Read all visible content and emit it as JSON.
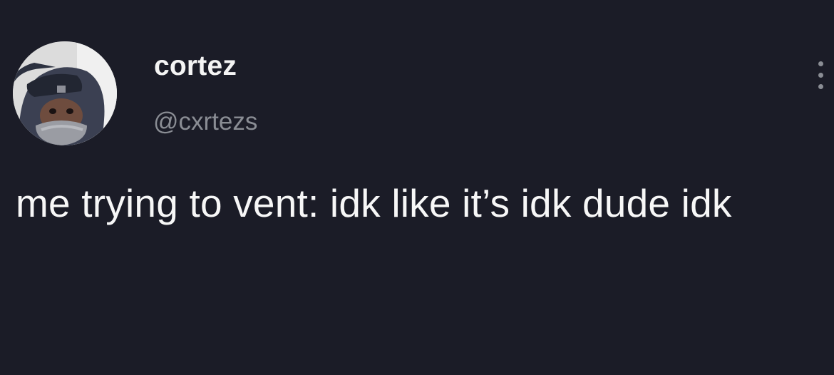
{
  "tweet": {
    "author": {
      "display_name": "cortez",
      "handle": "@cxrtezs",
      "avatar_icon": "profile-photo"
    },
    "more_icon": "more-vertical-icon",
    "text": "me trying to vent: idk like it’s idk dude idk"
  },
  "colors": {
    "background": "#1b1c27",
    "primary_text": "#f4f4f4",
    "secondary_text": "#8a8d94"
  }
}
